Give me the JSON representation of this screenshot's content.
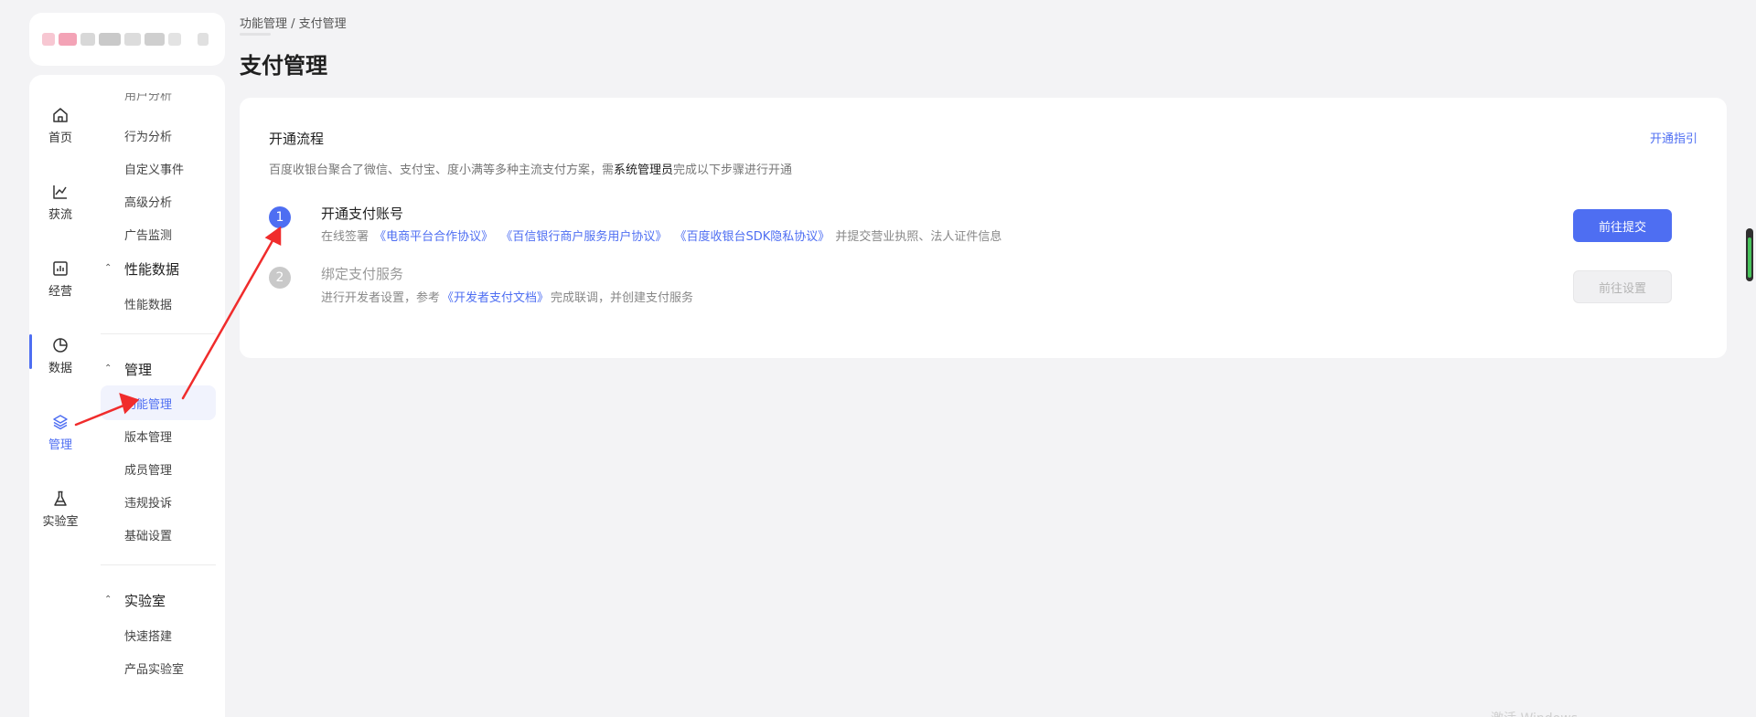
{
  "breadcrumb": "功能管理 / 支付管理",
  "page_title": "支付管理",
  "icon_nav": [
    {
      "label": "首页",
      "icon": "home-icon"
    },
    {
      "label": "获流",
      "icon": "line-chart-icon"
    },
    {
      "label": "经营",
      "icon": "bar-chart-icon"
    },
    {
      "label": "数据",
      "icon": "pie-chart-icon"
    },
    {
      "label": "管理",
      "icon": "layers-icon",
      "active": true
    },
    {
      "label": "实验室",
      "icon": "flask-icon"
    }
  ],
  "sub_nav": {
    "cut_item": "用户分析",
    "analysis_items": [
      "行为分析",
      "自定义事件",
      "高级分析",
      "广告监测"
    ],
    "performance_group": "性能数据",
    "performance_items": [
      "性能数据"
    ],
    "manage_group": "管理",
    "manage_items": [
      "功能管理",
      "版本管理",
      "成员管理",
      "违规投诉",
      "基础设置"
    ],
    "lab_group": "实验室",
    "lab_items": [
      "快速搭建",
      "产品实验室"
    ]
  },
  "card": {
    "title": "开通流程",
    "guide_link": "开通指引",
    "desc_prefix": "百度收银台聚合了微信、支付宝、度小满等多种主流支付方案，需",
    "desc_highlight": "系统管理员",
    "desc_suffix": "完成以下步骤进行开通"
  },
  "steps": [
    {
      "num": "1",
      "title": "开通支付账号",
      "desc_prefix": "在线签署",
      "links": [
        "《电商平台合作协议》",
        "《百信银行商户服务用户协议》",
        "《百度收银台SDK隐私协议》"
      ],
      "desc_suffix": "并提交营业执照、法人证件信息",
      "button": "前往提交"
    },
    {
      "num": "2",
      "title": "绑定支付服务",
      "desc_prefix": "进行开发者设置，参考",
      "link": "《开发者支付文档》",
      "desc_suffix": "完成联调，并创建支付服务",
      "button": "前往设置"
    }
  ],
  "watermark": "激活 Windows",
  "colors": {
    "accent": "#4e6ef2",
    "arrow": "#f02c2c",
    "background": "#f3f3f5"
  }
}
